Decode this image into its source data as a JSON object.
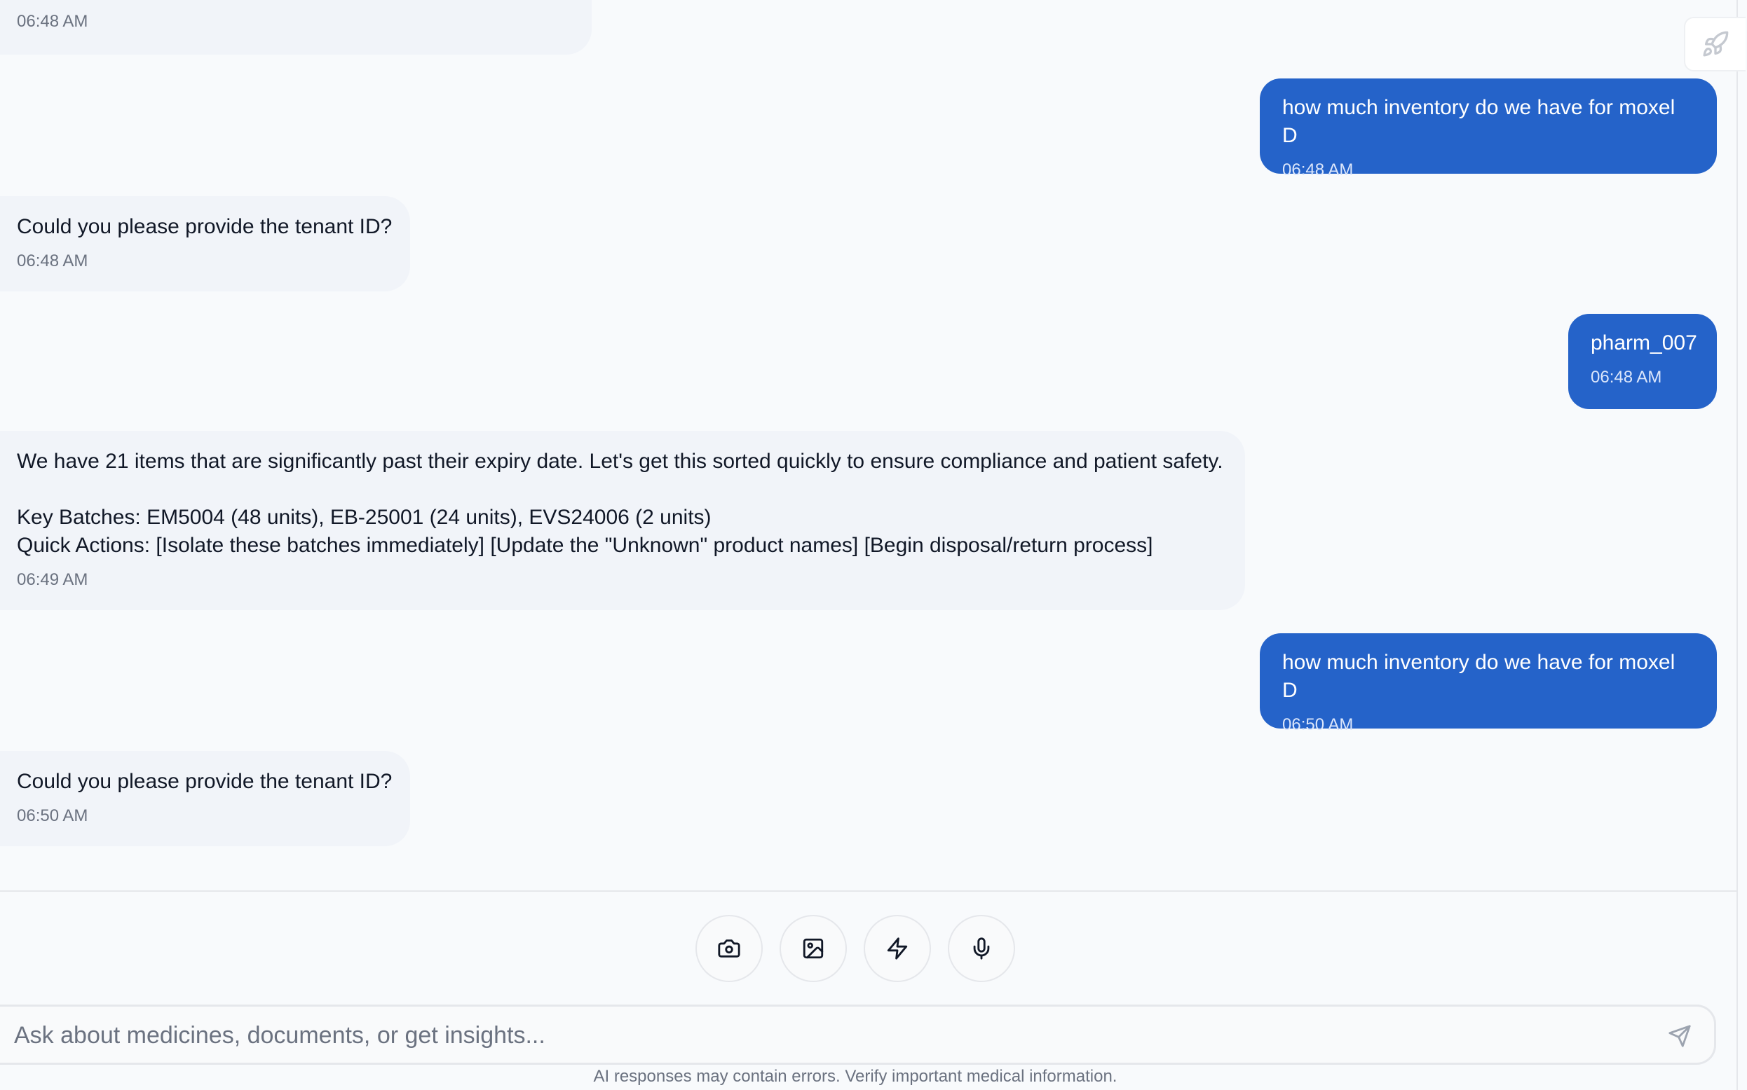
{
  "messages": [
    {
      "role": "bot",
      "text": "",
      "time": "06:48 AM"
    },
    {
      "role": "user",
      "text": "how much inventory do we have for moxel D",
      "time": "06:48 AM"
    },
    {
      "role": "bot",
      "text": "Could you please provide the tenant ID?",
      "time": "06:48 AM"
    },
    {
      "role": "user",
      "text": "pharm_007",
      "time": "06:48 AM"
    },
    {
      "role": "bot",
      "text": "We have 21 items that are significantly past their expiry date. Let's get this sorted quickly to ensure compliance and patient safety.\n\nKey Batches: EM5004 (48 units), EB-25001 (24 units), EVS24006 (2 units)\nQuick Actions: [Isolate these batches immediately] [Update the \"Unknown\" product names] [Begin disposal/return process]",
      "time": "06:49 AM"
    },
    {
      "role": "user",
      "text": "how much inventory do we have for moxel D",
      "time": "06:50 AM"
    },
    {
      "role": "bot",
      "text": "Could you please provide the tenant ID?",
      "time": "06:50 AM"
    }
  ],
  "toolbar": {
    "buttons": [
      {
        "icon": "camera-icon"
      },
      {
        "icon": "image-icon"
      },
      {
        "icon": "lightning-icon"
      },
      {
        "icon": "microphone-icon"
      }
    ]
  },
  "composer": {
    "placeholder": "Ask about medicines, documents, or get insights...",
    "value": "",
    "send_icon": "send-icon"
  },
  "disclaimer": "AI responses may contain errors. Verify important medical information.",
  "colors": {
    "user_bubble": "#2563c9",
    "bot_bubble": "#f1f4f9",
    "background": "#f8fafc"
  }
}
